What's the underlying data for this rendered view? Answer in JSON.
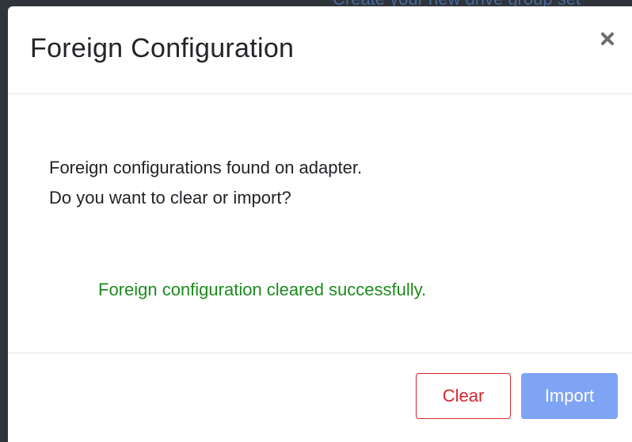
{
  "backdrop": {
    "text": "Create your new drive group set"
  },
  "dialog": {
    "title": "Foreign Configuration",
    "close_icon": "close-icon",
    "message_line1": "Foreign configurations found on adapter.",
    "message_line2": "Do you want to clear or import?",
    "status_message": "Foreign configuration cleared successfully.",
    "buttons": {
      "clear_label": "Clear",
      "import_label": "Import"
    }
  },
  "colors": {
    "success": "#1e8a1e",
    "danger": "#d9262e",
    "primary_disabled": "#7fa4f4"
  }
}
